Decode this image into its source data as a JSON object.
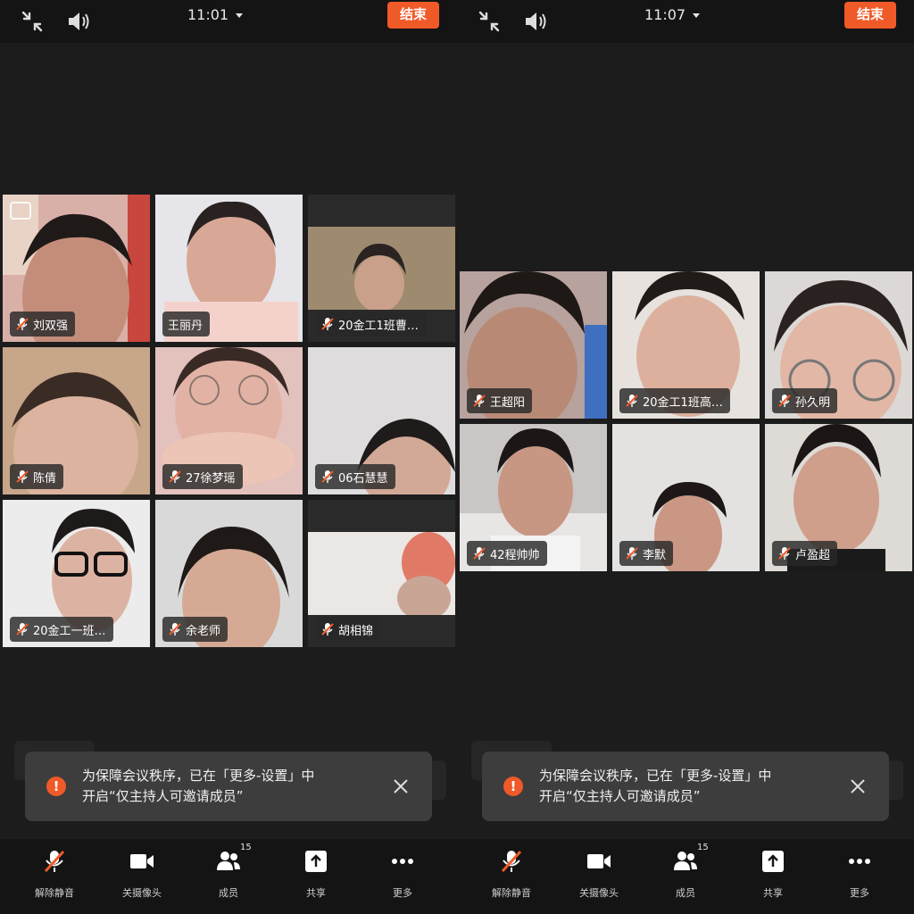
{
  "panels": [
    {
      "time": "11:01",
      "end_label": "结束",
      "participants": [
        {
          "name": "刘双强"
        },
        {
          "name": "王丽丹"
        },
        {
          "name": "20金工1班曹…"
        },
        {
          "name": "陈倩"
        },
        {
          "name": "27徐梦瑶"
        },
        {
          "name": "06石慧慧"
        },
        {
          "name": "20金工一班…"
        },
        {
          "name": "余老师"
        },
        {
          "name": "胡相锦"
        }
      ],
      "toast": {
        "line1": "为保障会议秩序，已在「更多-设置」中",
        "line2": "开启“仅主持人可邀请成员”"
      },
      "toolbar": {
        "unmute": "解除静音",
        "camera": "关摄像头",
        "members": "成员",
        "member_count": "15",
        "share": "共享",
        "more": "更多"
      }
    },
    {
      "time": "11:07",
      "end_label": "结束",
      "participants": [
        {
          "name": "王超阳"
        },
        {
          "name": "20金工1班高…"
        },
        {
          "name": "孙久明"
        },
        {
          "name": "42程帅帅"
        },
        {
          "name": "李默"
        },
        {
          "name": "卢盈超"
        }
      ],
      "toast": {
        "line1": "为保障会议秩序，已在「更多-设置」中",
        "line2": "开启“仅主持人可邀请成员”"
      },
      "toolbar": {
        "unmute": "解除静音",
        "camera": "关摄像头",
        "members": "成员",
        "member_count": "15",
        "share": "共享",
        "more": "更多"
      }
    }
  ],
  "colors": {
    "accent": "#f05a28",
    "active_speaker": "#23c55e"
  },
  "icons": [
    "exit-fullscreen-icon",
    "speaker-icon",
    "mic-muted-icon",
    "camera-icon",
    "members-icon",
    "share-icon",
    "more-icon",
    "warning-icon",
    "close-icon",
    "camera-switch-icon"
  ]
}
